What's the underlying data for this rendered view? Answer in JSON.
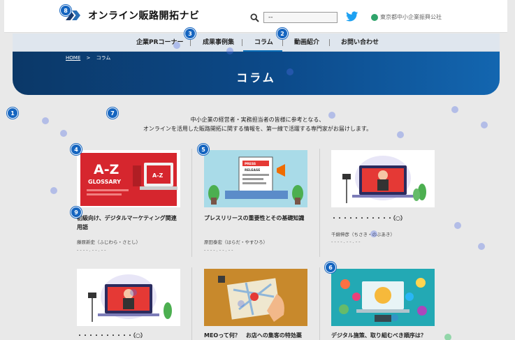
{
  "header": {
    "logo_text": "オンライン販路開拓ナビ",
    "search_value": "--",
    "gov_name": "東京都中小企業振興公社"
  },
  "nav": {
    "items": [
      {
        "label": "企業PRコーナー"
      },
      {
        "label": "成果事例集"
      },
      {
        "label": "コラム"
      },
      {
        "label": "動画紹介"
      },
      {
        "label": "お問い合わせ"
      }
    ],
    "active": "コラム"
  },
  "hero": {
    "breadcrumb_home": "HOME",
    "breadcrumb_sep": ">",
    "breadcrumb_current": "コラム",
    "title": "コラム"
  },
  "intro": {
    "line1": "中小企業の経営者・実務担当者の皆様に参考となる、",
    "line2": "オンラインを活用した販路開拓に関する情報を、第一線で活躍する専門家がお届けします。"
  },
  "cards": [
    {
      "title": "初級向け、デジタルマーケティング関連用語",
      "author": "藤原新史（ふじわら・さとし）",
      "date": "- - - - . - - . - -",
      "thumb": "glossary"
    },
    {
      "title": "プレスリリースの重要性とその基礎知識",
      "author": "原田泰宏（はらだ・やすひろ）",
      "date": "- - - - . - - . - -",
      "thumb": "press"
    },
    {
      "title": "・・・・・・・・・・・（○）",
      "author": "千綿伸彦（ちさき・のぶあき）",
      "date": "- - - - . - - . - -",
      "thumb": "video"
    },
    {
      "title": "・・・・・・・・・・（○）",
      "author": "",
      "date": "",
      "thumb": "video"
    },
    {
      "title": "MEOって何？　お店への集客の特効薬",
      "author": "",
      "date": "",
      "thumb": "map"
    },
    {
      "title": "デジタル施策、取り組むべき順序は？",
      "author": "",
      "date": "",
      "thumb": "digital"
    }
  ],
  "markers": [
    "1",
    "2",
    "3",
    "4",
    "5",
    "6",
    "7",
    "8",
    "9"
  ],
  "colors": {
    "hero": "#0c4a8a",
    "accent": "#0a6eb8",
    "marker": "#1565c0",
    "twitter": "#1da1f2"
  }
}
